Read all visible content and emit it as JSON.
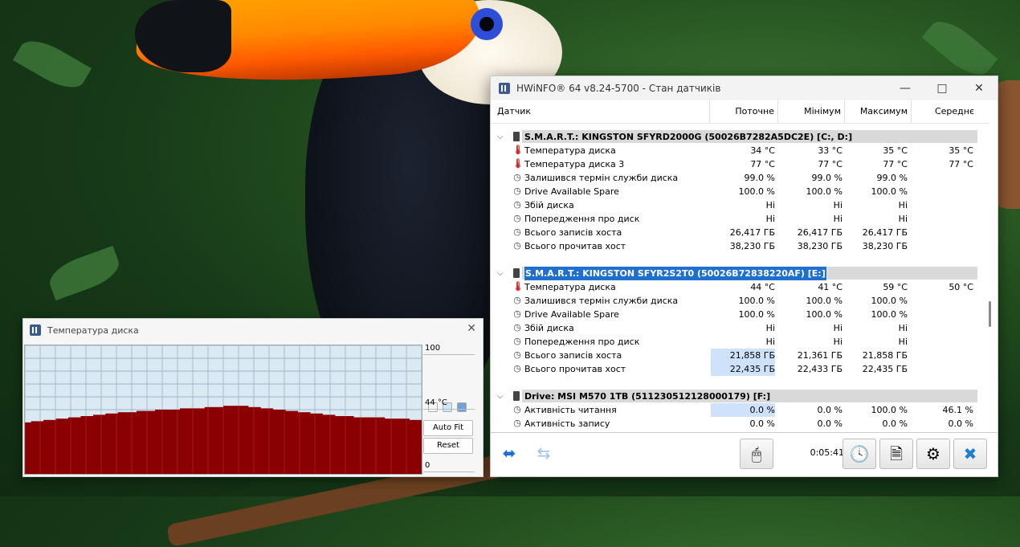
{
  "main_window": {
    "title": "HWiNFO® 64 v8.24-5700 - Стан датчиків",
    "columns": [
      "Датчик",
      "Поточне",
      "Мінімум",
      "Максимум",
      "Середнє"
    ],
    "groups": [
      {
        "name": "S.M.A.R.T.: KINGSTON SFYRD2000G (50026B7282A5DC2E) [C:, D:]",
        "selected": false,
        "rows": [
          {
            "icon": "thermometer-icon",
            "name": "Температура диска",
            "cur": "34 °C",
            "min": "33 °C",
            "max": "35 °C",
            "avg": "35 °C"
          },
          {
            "icon": "thermometer-icon",
            "name": "Температура диска 3",
            "cur": "77 °C",
            "min": "77 °C",
            "max": "77 °C",
            "avg": "77 °C"
          },
          {
            "icon": "clock-icon",
            "name": "Залишився термін служби диска",
            "cur": "99.0 %",
            "min": "99.0 %",
            "max": "99.0 %",
            "avg": ""
          },
          {
            "icon": "clock-icon",
            "name": "Drive Available Spare",
            "cur": "100.0 %",
            "min": "100.0 %",
            "max": "100.0 %",
            "avg": ""
          },
          {
            "icon": "clock-icon",
            "name": "Збій диска",
            "cur": "Ні",
            "min": "Ні",
            "max": "Ні",
            "avg": ""
          },
          {
            "icon": "clock-icon",
            "name": "Попередження про диск",
            "cur": "Ні",
            "min": "Ні",
            "max": "Ні",
            "avg": ""
          },
          {
            "icon": "clock-icon",
            "name": "Всього записів хоста",
            "cur": "26,417 ГБ",
            "min": "26,417 ГБ",
            "max": "26,417 ГБ",
            "avg": ""
          },
          {
            "icon": "clock-icon",
            "name": "Всього прочитав хост",
            "cur": "38,230 ГБ",
            "min": "38,230 ГБ",
            "max": "38,230 ГБ",
            "avg": ""
          }
        ]
      },
      {
        "name": "S.M.A.R.T.: KINGSTON SFYR2S2T0 (50026B72838220AF) [E:]",
        "selected": true,
        "rows": [
          {
            "icon": "thermometer-icon",
            "name": "Температура диска",
            "cur": "44 °C",
            "min": "41 °C",
            "max": "59 °C",
            "avg": "50 °C"
          },
          {
            "icon": "clock-icon",
            "name": "Залишився термін служби диска",
            "cur": "100.0 %",
            "min": "100.0 %",
            "max": "100.0 %",
            "avg": ""
          },
          {
            "icon": "clock-icon",
            "name": "Drive Available Spare",
            "cur": "100.0 %",
            "min": "100.0 %",
            "max": "100.0 %",
            "avg": ""
          },
          {
            "icon": "clock-icon",
            "name": "Збій диска",
            "cur": "Ні",
            "min": "Ні",
            "max": "Ні",
            "avg": ""
          },
          {
            "icon": "clock-icon",
            "name": "Попередження про диск",
            "cur": "Ні",
            "min": "Ні",
            "max": "Ні",
            "avg": ""
          },
          {
            "icon": "clock-icon",
            "name": "Всього записів хоста",
            "cur": "21,858 ГБ",
            "min": "21,361 ГБ",
            "max": "21,858 ГБ",
            "avg": "",
            "hl": true
          },
          {
            "icon": "clock-icon",
            "name": "Всього прочитав хост",
            "cur": "22,435 ГБ",
            "min": "22,433 ГБ",
            "max": "22,435 ГБ",
            "avg": "",
            "hl": true
          }
        ]
      },
      {
        "name": "Drive: MSI M570 1TB (511230512128000179) [F:]",
        "selected": false,
        "rows": [
          {
            "icon": "clock-icon",
            "name": "Активність читання",
            "cur": "0.0 %",
            "min": "0.0 %",
            "max": "100.0 %",
            "avg": "46.1 %",
            "hl": true
          },
          {
            "icon": "clock-icon",
            "name": "Активність запису",
            "cur": "0.0 %",
            "min": "0.0 %",
            "max": "0.0 %",
            "avg": "0.0 %"
          }
        ]
      }
    ],
    "footer": {
      "elapsed": "0:05:41"
    }
  },
  "graph_window": {
    "title": "Температура диска",
    "max_label": "100",
    "current_label": "44 °C",
    "min_label": "0",
    "autofit_label": "Auto Fit",
    "reset_label": "Reset",
    "series_color": "#8b0000"
  },
  "chart_data": {
    "type": "area",
    "ylim": [
      0,
      100
    ],
    "values": [
      40,
      41,
      41,
      42,
      42,
      43,
      43,
      44,
      44,
      45,
      45,
      46,
      46,
      47,
      47,
      48,
      48,
      48,
      49,
      49,
      49,
      50,
      50,
      50,
      50,
      51,
      51,
      51,
      51,
      52,
      52,
      52,
      53,
      53,
      53,
      53,
      52,
      52,
      51,
      51,
      50,
      50,
      49,
      49,
      48,
      48,
      47,
      47,
      46,
      46,
      45,
      45,
      45,
      44,
      44,
      44,
      44,
      44,
      43,
      43,
      43,
      43,
      42,
      42
    ]
  }
}
